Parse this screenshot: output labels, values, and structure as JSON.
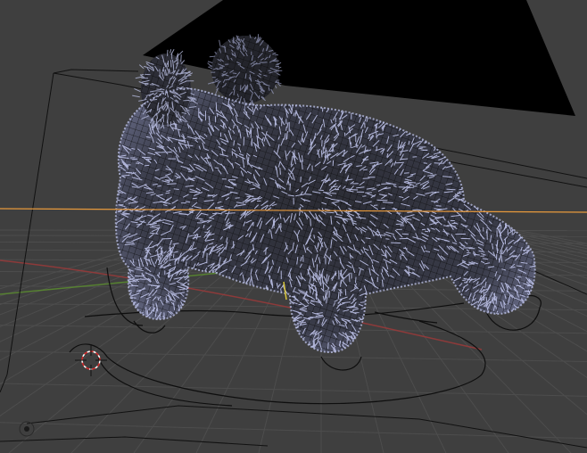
{
  "viewport": {
    "name": "3D Viewport",
    "shading": "wireframe",
    "colors": {
      "background": "#3f3f3f",
      "grid": "#4d4d4d",
      "x_axis": "#9b3a3a",
      "y_axis": "#5b8c2f",
      "selected_edge": "#e89a3c",
      "fur": "#c8cdf5",
      "wire": "#111111",
      "camera_plane": "#000000",
      "cursor_red": "#d42a2a"
    },
    "icons": {
      "cursor": "3d-cursor-icon",
      "object_origin": "object-origin-icon",
      "lamp": "lamp-icon"
    }
  }
}
